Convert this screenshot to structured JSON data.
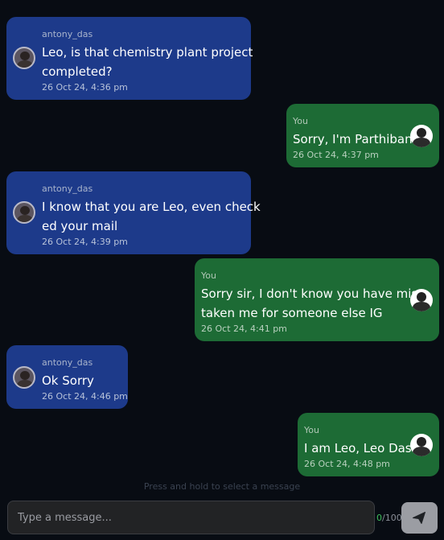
{
  "messages": [
    {
      "sender": "antony_das",
      "lines": [
        "Leo, is that chemistry plant project",
        "completed?"
      ],
      "time": "26 Oct 24, 4:36 pm"
    },
    {
      "sender": "You",
      "lines": [
        "Sorry, I'm Parthiban"
      ],
      "time": "26 Oct 24, 4:37 pm"
    },
    {
      "sender": "antony_das",
      "lines": [
        "I know that you are Leo, even check",
        "ed your mail"
      ],
      "time": "26 Oct 24, 4:39 pm"
    },
    {
      "sender": "You",
      "lines": [
        "Sorry sir, I don't know you have mis",
        "taken me for someone else IG"
      ],
      "time": "26 Oct 24, 4:41 pm"
    },
    {
      "sender": "antony_das",
      "lines": [
        "Ok Sorry"
      ],
      "time": "26 Oct 24, 4:46 pm"
    },
    {
      "sender": "You",
      "lines": [
        "I am Leo, Leo Das"
      ],
      "time": "26 Oct 24, 4:48 pm"
    }
  ],
  "hint": "Press and hold to select a message",
  "composer": {
    "placeholder": "Type a message...",
    "value": "",
    "char_count": "0",
    "char_limit": "/100"
  },
  "icons": {
    "send": "send-icon",
    "avatar_in": "avatar",
    "avatar_out": "avatar"
  },
  "colors": {
    "background": "#080c13",
    "incoming_bubble": "#1d3a8a",
    "outgoing_bubble": "#1d6b35",
    "counter_accent": "#3fbf5c",
    "send_button": "#9b9da3"
  }
}
